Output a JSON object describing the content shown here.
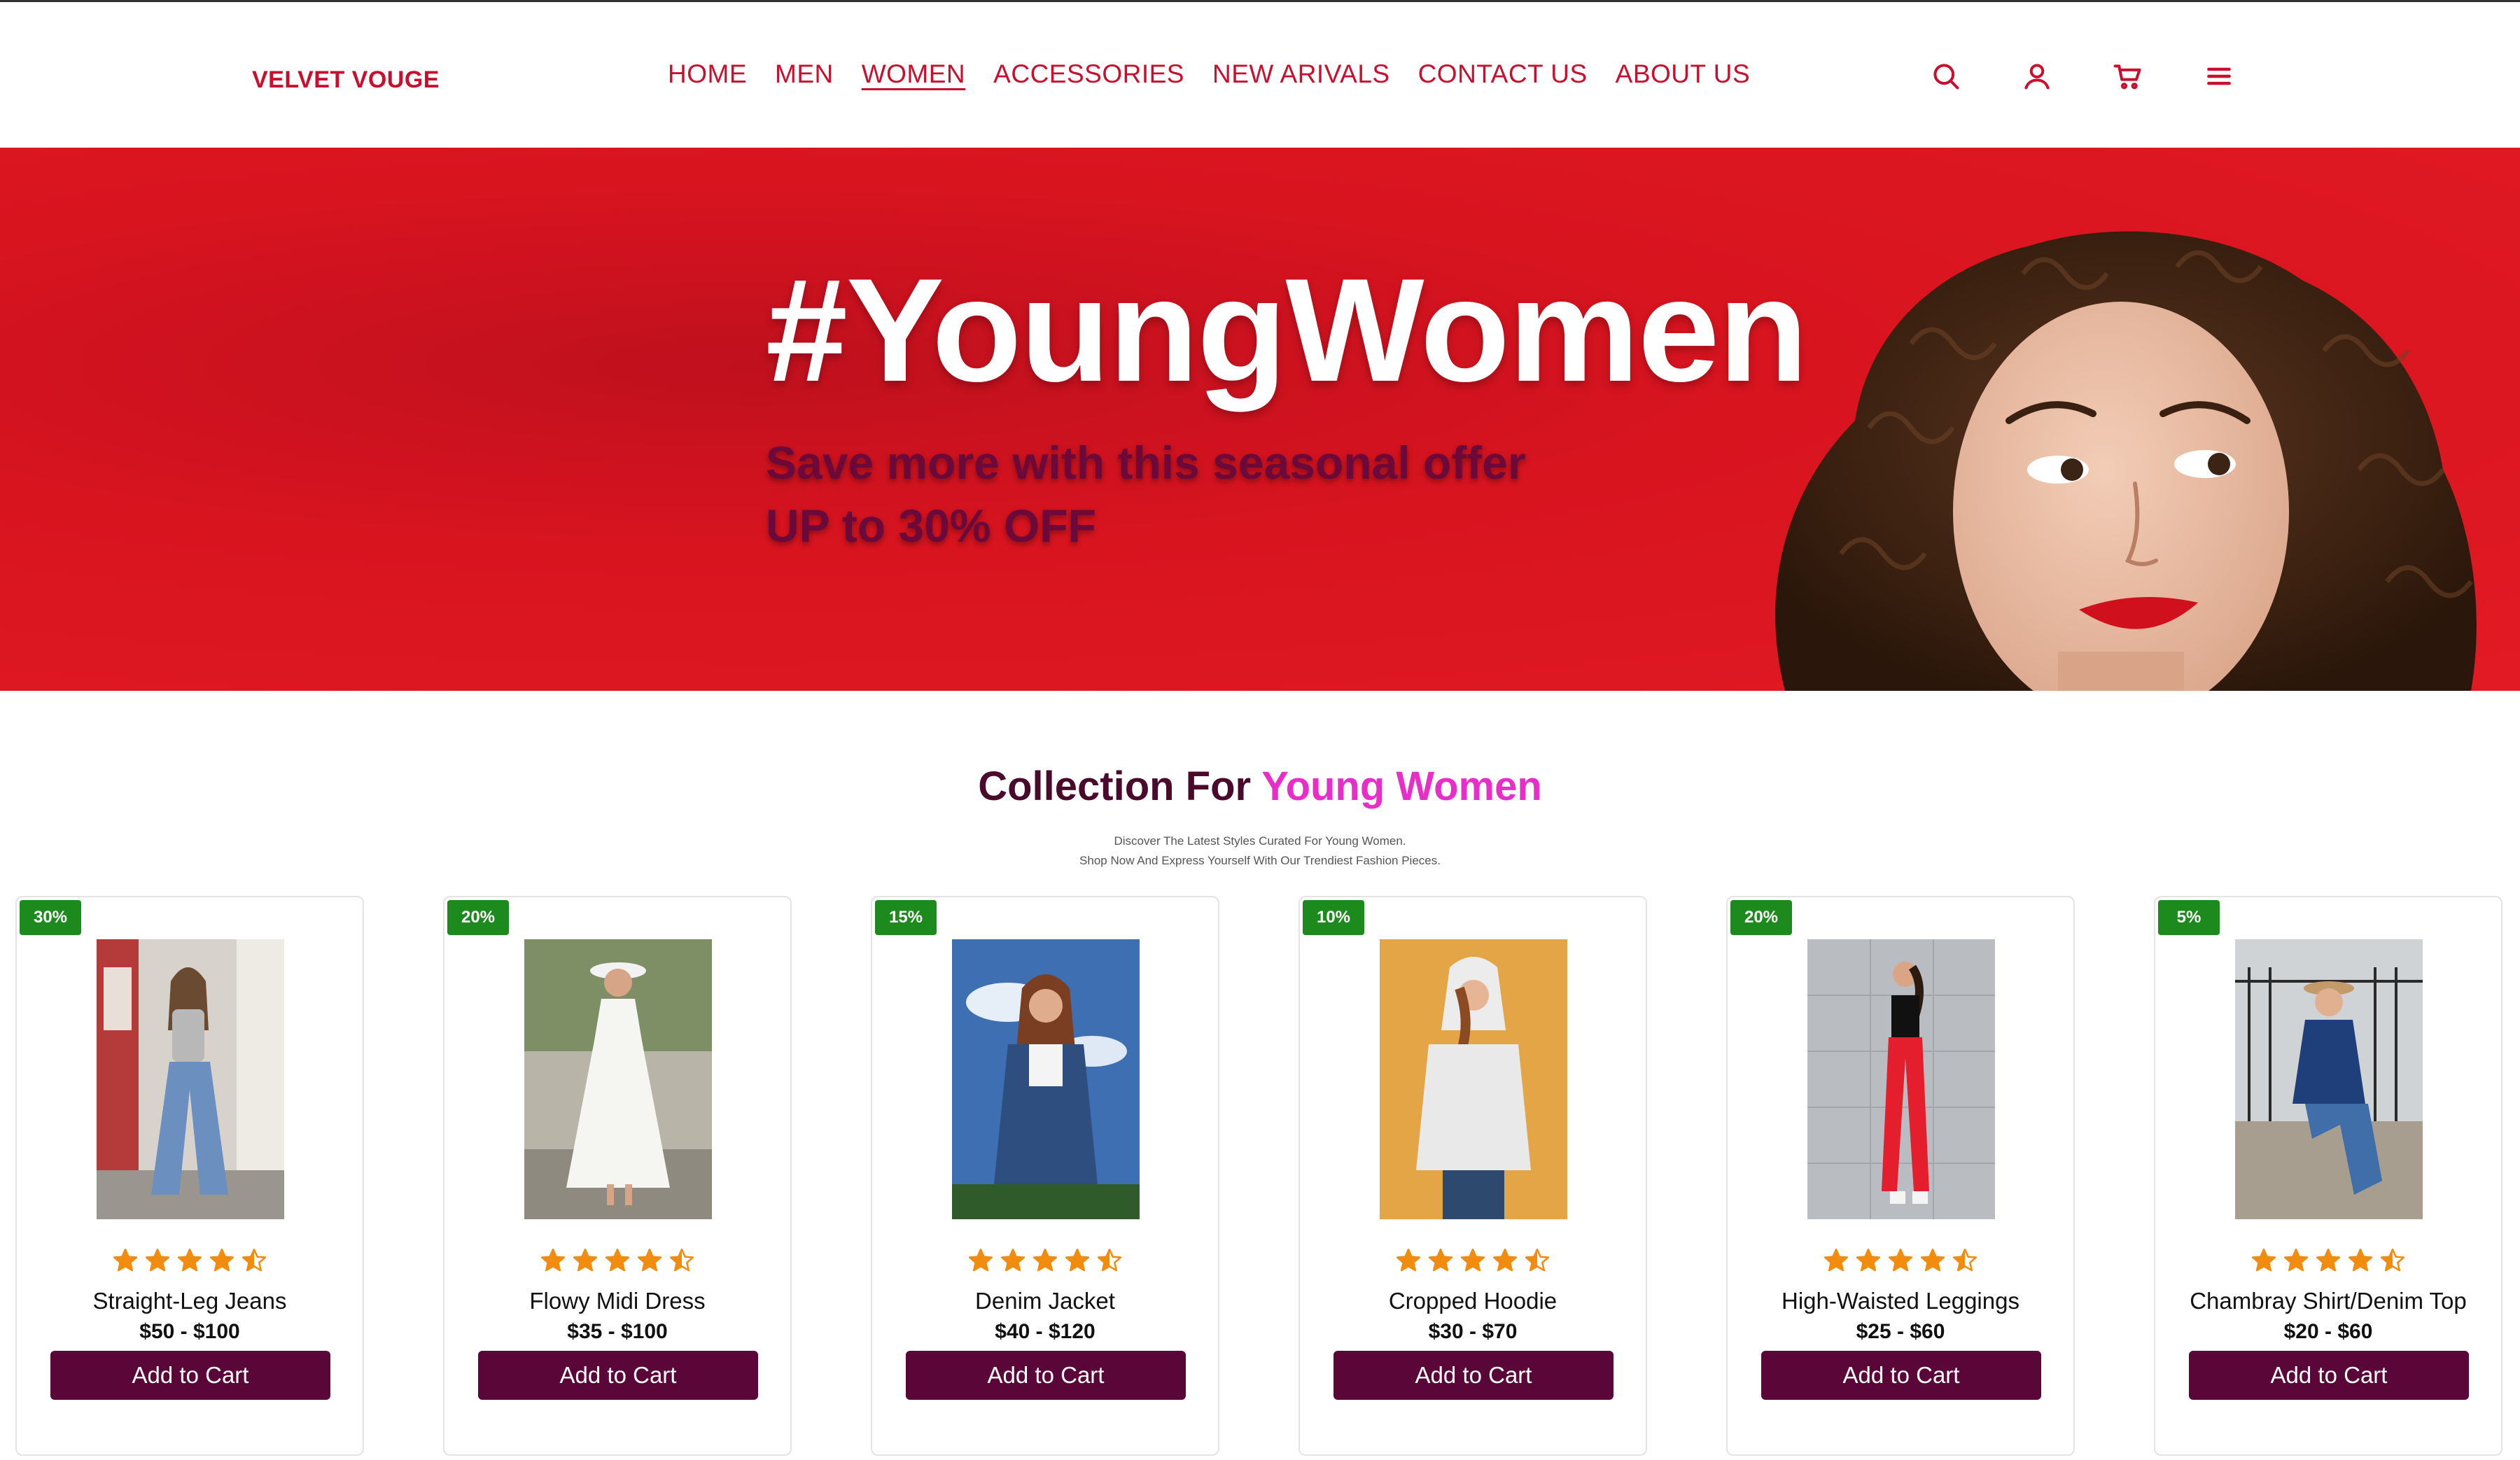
{
  "brand": {
    "logo": "VELVET VOUGE"
  },
  "nav": {
    "items": [
      {
        "label": "HOME"
      },
      {
        "label": "MEN"
      },
      {
        "label": "WOMEN",
        "active": true
      },
      {
        "label": "ACCESSORIES"
      },
      {
        "label": "NEW ARIVALS"
      },
      {
        "label": "CONTACT US"
      },
      {
        "label": "ABOUT US"
      }
    ]
  },
  "header_icons": [
    "search-icon",
    "user-icon",
    "cart-icon",
    "menu-icon"
  ],
  "hero": {
    "title": "#YoungWomen",
    "line1": "Save more with this seasonal offer",
    "line2": "UP to 30% OFF"
  },
  "collection": {
    "title_prefix": "Collection For",
    "title_accent": "Young Women",
    "subtitle_line1": "Discover The Latest Styles Curated For Young Women.",
    "subtitle_line2": "Shop Now And Express Yourself With Our Trendiest Fashion Pieces."
  },
  "products": [
    {
      "badge": "30%",
      "name": "Straight-Leg Jeans",
      "price": "$50 - $100",
      "rating": 4.5,
      "button": "Add to Cart"
    },
    {
      "badge": "20%",
      "name": "Flowy Midi Dress",
      "price": "$35 - $100",
      "rating": 4.5,
      "button": "Add to Cart"
    },
    {
      "badge": "15%",
      "name": "Denim Jacket",
      "price": "$40 - $120",
      "rating": 4.5,
      "button": "Add to Cart"
    },
    {
      "badge": "10%",
      "name": "Cropped Hoodie",
      "price": "$30 - $70",
      "rating": 4.5,
      "button": "Add to Cart"
    },
    {
      "badge": "20%",
      "name": "High-Waisted Leggings",
      "price": "$25 - $60",
      "rating": 4.5,
      "button": "Add to Cart"
    },
    {
      "badge": "5%",
      "name": "Chambray Shirt/Denim Top",
      "price": "$20 - $60",
      "rating": 4.5,
      "button": "Add to Cart"
    }
  ],
  "colors": {
    "brand_red": "#c8102e",
    "hero_red": "#e21a24",
    "button_plum": "#5a0638",
    "accent_pink": "#e82ec8",
    "badge_green": "#1d8a1d",
    "star_orange": "#f28c0f"
  }
}
